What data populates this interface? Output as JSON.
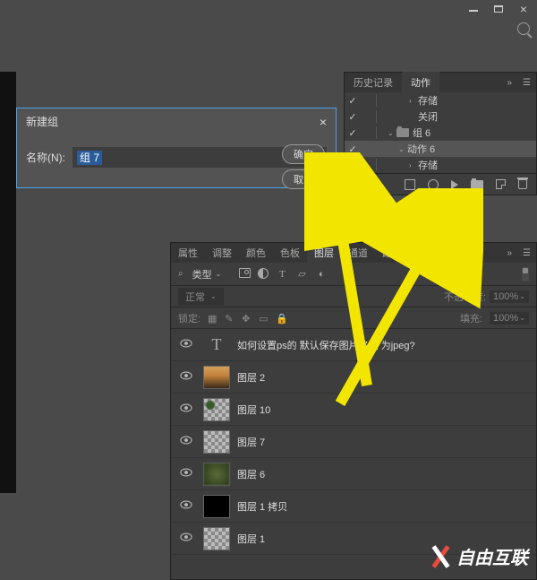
{
  "window": {
    "min": "_",
    "max": "□",
    "close": "×"
  },
  "dialog": {
    "title": "新建组",
    "close": "×",
    "name_label": "名称(N):",
    "name_value": "组 7",
    "ok": "确定",
    "cancel": "取消"
  },
  "actions_panel": {
    "tab_history": "历史记录",
    "tab_actions": "动作",
    "menu_more": "»",
    "items": [
      {
        "label": "存储",
        "indent": 3,
        "caret": "›",
        "checked": true
      },
      {
        "label": "关闭",
        "indent": 3,
        "caret": "",
        "checked": true
      },
      {
        "label": "组 6",
        "indent": 1,
        "caret": "⌄",
        "checked": true,
        "folder": true
      },
      {
        "label": "动作 6",
        "indent": 2,
        "caret": "⌄",
        "checked": true,
        "selected": true
      },
      {
        "label": "存储",
        "indent": 3,
        "caret": "›",
        "checked": true
      }
    ]
  },
  "layers_panel": {
    "tabs": [
      "属性",
      "调整",
      "颜色",
      "色板",
      "图层",
      "通道",
      "路径"
    ],
    "active_tab": 4,
    "filter_label": "类型",
    "filter_icons": [
      "image",
      "adjust",
      "T",
      "shape",
      "smart"
    ],
    "blend_mode": "正常",
    "opacity_label": "不透明度:",
    "opacity_value": "100%",
    "lock_label": "锁定:",
    "fill_label": "填充:",
    "fill_value": "100%",
    "layers": [
      {
        "name": "如何设置ps的 默认保存图片格式 为jpeg?",
        "thumb": "text"
      },
      {
        "name": "图层 2",
        "thumb": "sunset"
      },
      {
        "name": "图层 10",
        "thumb": "leaves"
      },
      {
        "name": "图层 7",
        "thumb": "checker"
      },
      {
        "name": "图层 6",
        "thumb": "blur"
      },
      {
        "name": "图层 1 拷贝",
        "thumb": "black"
      },
      {
        "name": "图层 1",
        "thumb": "checker"
      }
    ]
  },
  "watermark": "自由互联"
}
